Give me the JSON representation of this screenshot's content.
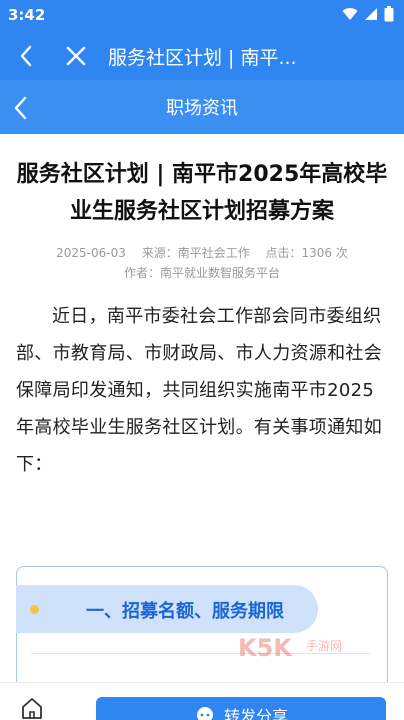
{
  "status_bar": {
    "time": "3:42"
  },
  "app_bar": {
    "title": "服务社区计划 | 南平..."
  },
  "sub_bar": {
    "title": "职场资讯"
  },
  "article": {
    "headline": "服务社区计划 | 南平市2025年高校毕业生服务社区计划招募方案",
    "date": "2025-06-03",
    "source": "来源：南平社会工作",
    "views": "点击：1306 次",
    "author": "作者：南平就业数智服务平台",
    "paragraph": "近日，南平市委社会工作部会同市委组织部、市教育局、市财政局、市人力资源和社会保障局印发通知，共同组织实施南平市2025年高校毕业生服务社区计划。有关事项通知如下："
  },
  "section_card": {
    "heading": "一、招募名额、服务期限"
  },
  "watermark": {
    "text": "K5K",
    "subtext": "手游网"
  },
  "bottom_bar": {
    "share_label": "转发分享"
  },
  "colors": {
    "primary": "#2f86f0",
    "pill_bg": "#cfe1fb",
    "pill_text": "#1c66d4",
    "dot": "#f4c542"
  }
}
